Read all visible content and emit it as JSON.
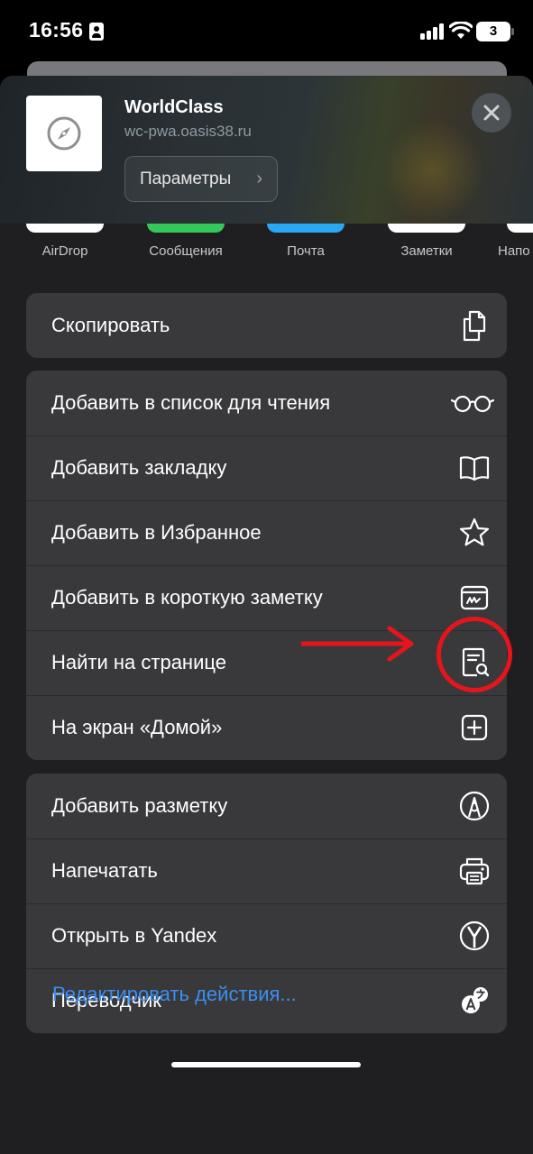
{
  "status_bar": {
    "time": "16:56",
    "battery": "3"
  },
  "header": {
    "title": "WorldClass",
    "url": "wc-pwa.oasis38.ru",
    "params_label": "Параметры",
    "params_chevron": "›",
    "app_icon": "compass-icon",
    "close_icon": "close-icon"
  },
  "share_targets": [
    {
      "label": "AirDrop",
      "color": "#ffffff"
    },
    {
      "label": "Сообщения",
      "color": "#34c759"
    },
    {
      "label": "Почта",
      "color": "#2aa7f5"
    },
    {
      "label": "Заметки",
      "color": "#ffffff"
    },
    {
      "label": "Напо",
      "color": "#ffffff"
    }
  ],
  "groups": [
    {
      "rows": [
        {
          "label": "Скопировать",
          "icon": "copy-icon"
        }
      ]
    },
    {
      "rows": [
        {
          "label": "Добавить в список для чтения",
          "icon": "glasses-icon"
        },
        {
          "label": "Добавить закладку",
          "icon": "book-icon"
        },
        {
          "label": "Добавить в Избранное",
          "icon": "star-icon"
        },
        {
          "label": "Добавить в короткую заметку",
          "icon": "quick-note-icon"
        },
        {
          "label": "Найти на странице",
          "icon": "find-on-page-icon"
        },
        {
          "label": "На экран «Домой»",
          "icon": "add-square-icon"
        }
      ]
    },
    {
      "rows": [
        {
          "label": "Добавить разметку",
          "icon": "markup-icon"
        },
        {
          "label": "Напечатать",
          "icon": "printer-icon"
        },
        {
          "label": "Открыть в Yandex",
          "icon": "yandex-icon"
        },
        {
          "label": "Переводчик",
          "icon": "translate-icon"
        }
      ]
    }
  ],
  "edit_actions_label": "Редактировать действия...",
  "colors": {
    "accent_link": "#3b8ef0",
    "annotation": "#e8141b",
    "row_background": "#39393c",
    "sheet_background": "#1f1f21"
  }
}
